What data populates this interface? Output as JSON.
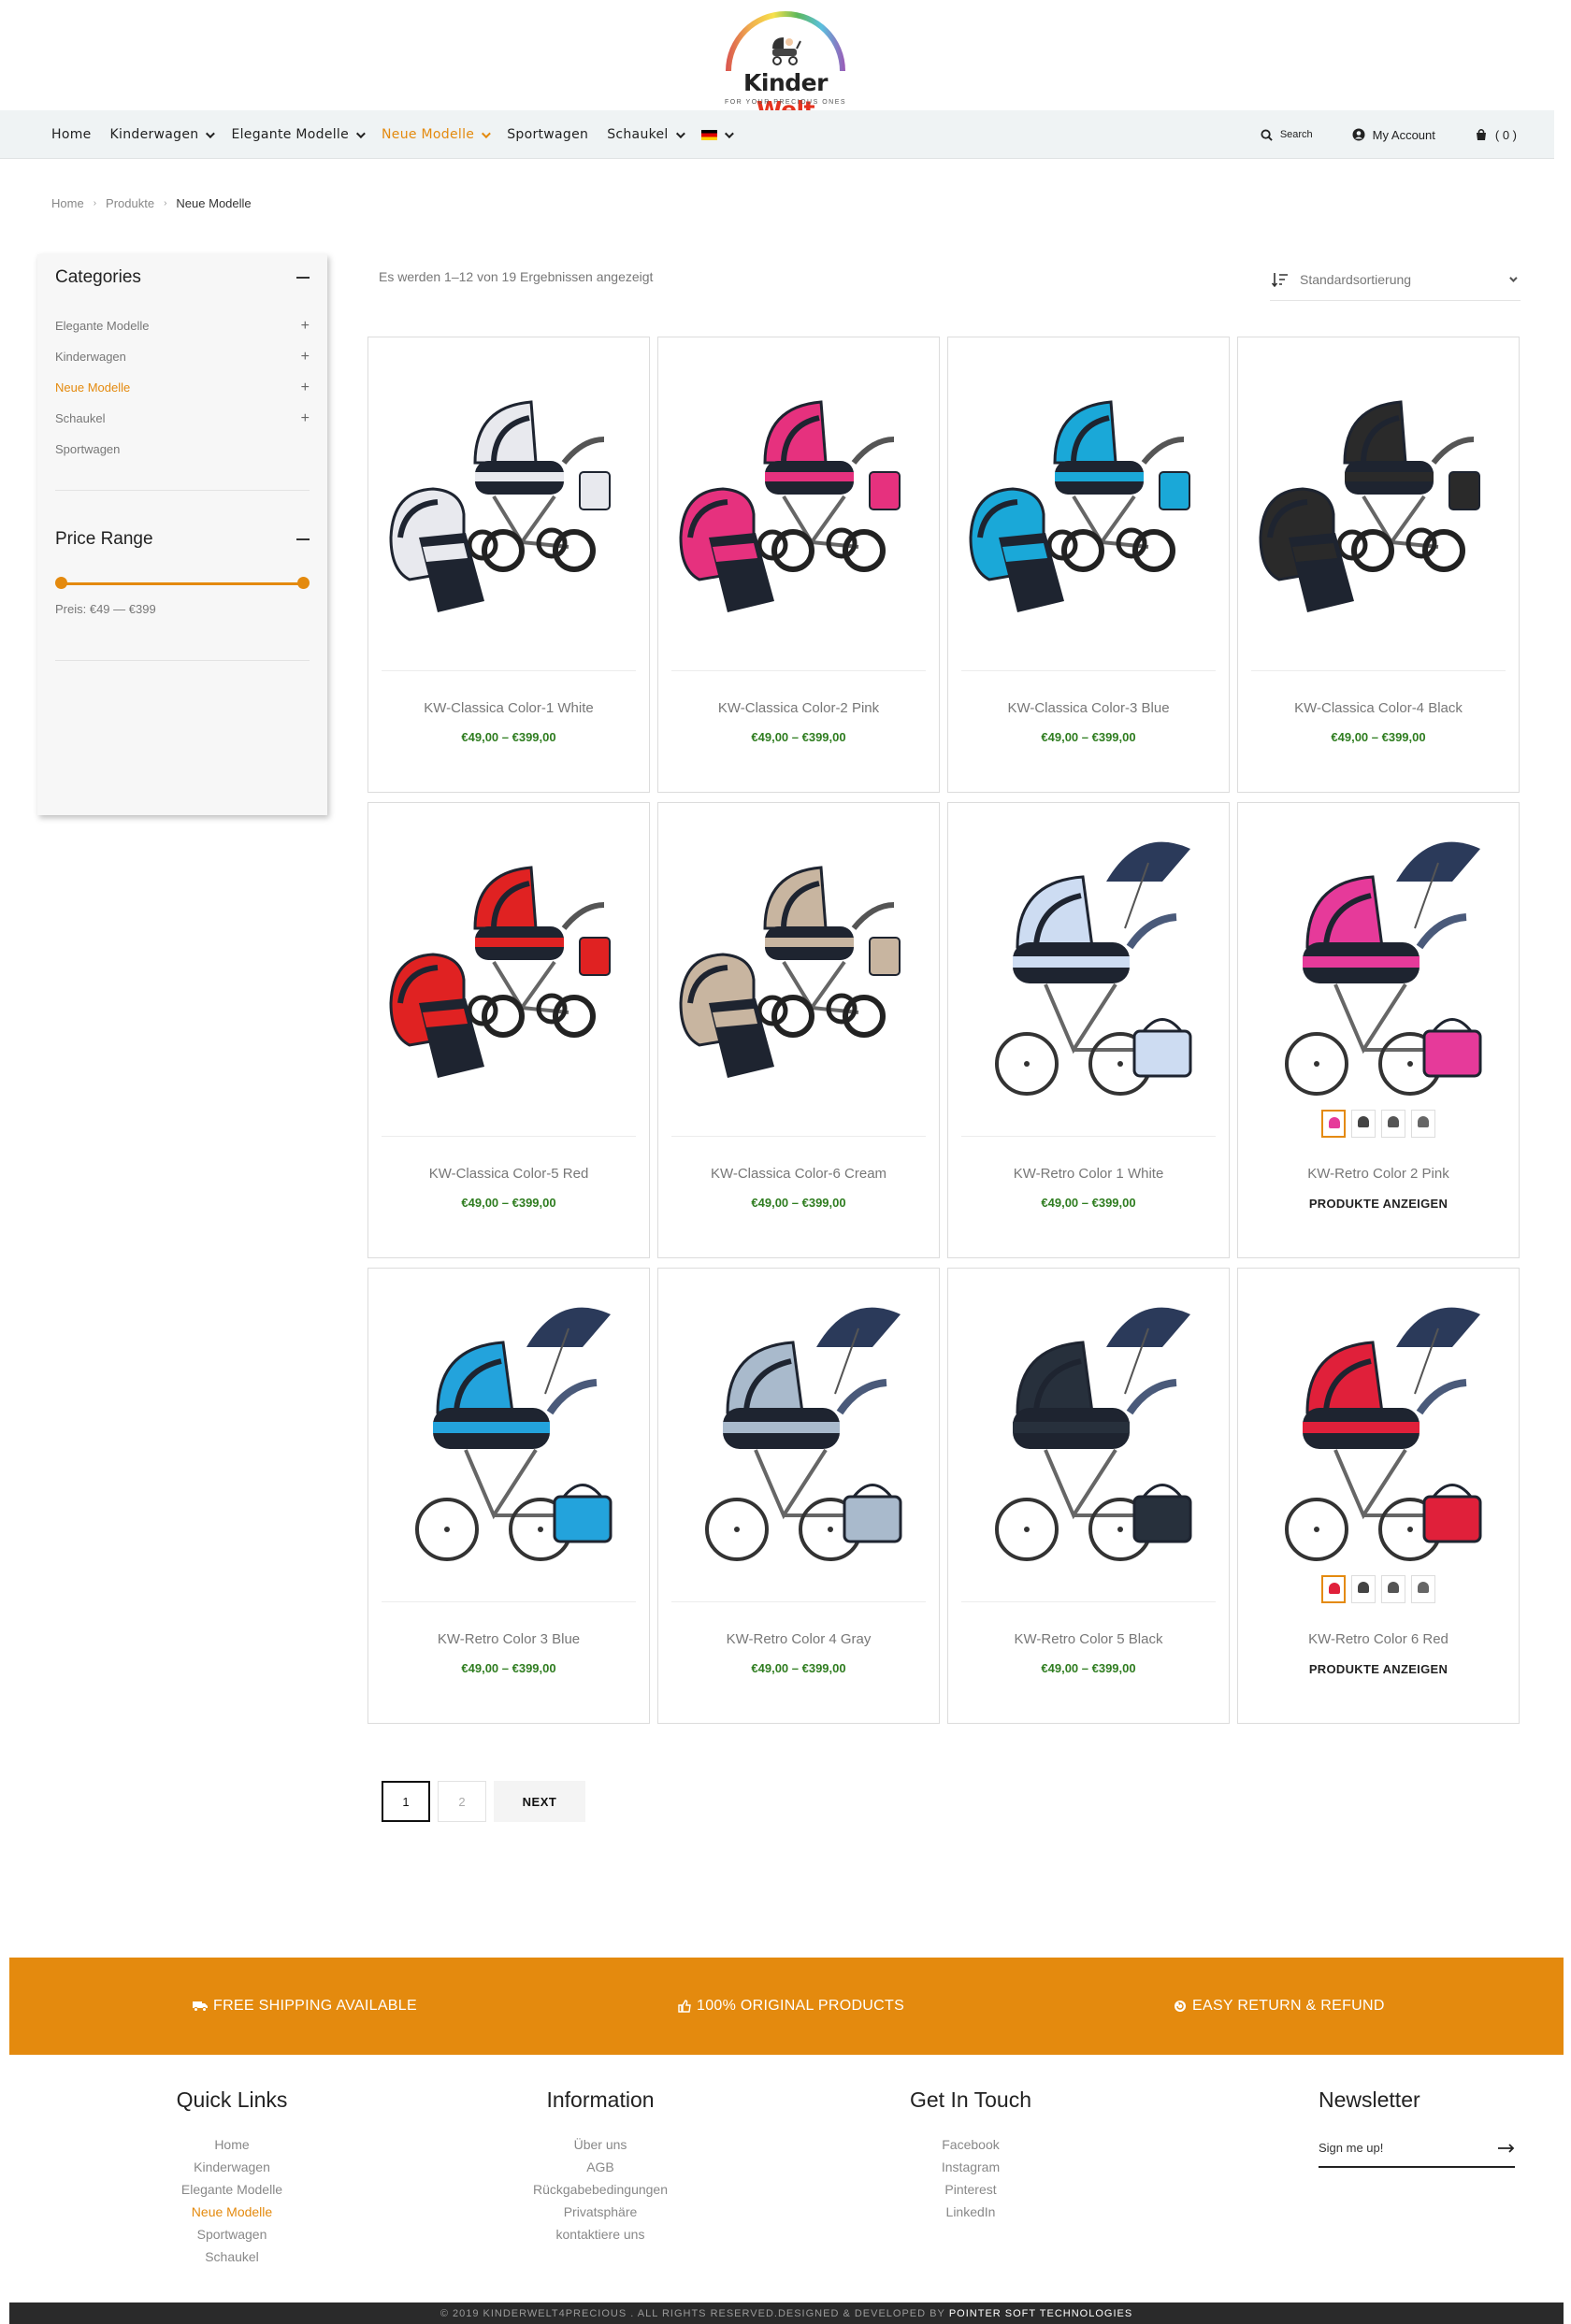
{
  "brand": {
    "name_part1": "Kinder",
    "name_part2": "Welt",
    "tagline": "FOR YOUR PRECIOUS ONES"
  },
  "nav": {
    "items": [
      {
        "label": "Home",
        "dropdown": false,
        "active": false
      },
      {
        "label": "Kinderwagen",
        "dropdown": true,
        "active": false
      },
      {
        "label": "Elegante Modelle",
        "dropdown": true,
        "active": false
      },
      {
        "label": "Neue Modelle",
        "dropdown": true,
        "active": true
      },
      {
        "label": "Sportwagen",
        "dropdown": false,
        "active": false
      },
      {
        "label": "Schaukel",
        "dropdown": true,
        "active": false
      }
    ],
    "search_label": "Search",
    "account_label": "My Account",
    "cart_label": "( 0 )"
  },
  "breadcrumb": [
    "Home",
    "Produkte",
    "Neue Modelle"
  ],
  "sidebar": {
    "categories_title": "Categories",
    "categories": [
      {
        "label": "Elegante Modelle",
        "expandable": true,
        "active": false
      },
      {
        "label": "Kinderwagen",
        "expandable": true,
        "active": false
      },
      {
        "label": "Neue Modelle",
        "expandable": true,
        "active": true
      },
      {
        "label": "Schaukel",
        "expandable": true,
        "active": false
      },
      {
        "label": "Sportwagen",
        "expandable": false,
        "active": false
      }
    ],
    "price_title": "Price Range",
    "price_label": "Preis: €49 — €399",
    "price_min": 49,
    "price_max": 399
  },
  "result_count": "Es werden 1–12 von 19 Ergebnissen angezeigt",
  "sort_label": "Standardsortierung",
  "products": [
    {
      "name": "KW-Classica Color-1 White",
      "price": "€49,00 – €399,00",
      "color": "#e8e9ee",
      "style": "classica"
    },
    {
      "name": "KW-Classica Color-2 Pink",
      "price": "€49,00 – €399,00",
      "color": "#e6317e",
      "style": "classica"
    },
    {
      "name": "KW-Classica Color-3 Blue",
      "price": "€49,00 – €399,00",
      "color": "#1aa8d8",
      "style": "classica"
    },
    {
      "name": "KW-Classica Color-4 Black",
      "price": "€49,00 – €399,00",
      "color": "#2a2a2a",
      "style": "classica"
    },
    {
      "name": "KW-Classica Color-5 Red",
      "price": "€49,00 – €399,00",
      "color": "#e02222",
      "style": "classica"
    },
    {
      "name": "KW-Classica Color-6 Cream",
      "price": "€49,00 – €399,00",
      "color": "#c8b5a0",
      "style": "classica"
    },
    {
      "name": "KW-Retro Color 1 White",
      "price": "€49,00 – €399,00",
      "color": "#cddcf2",
      "style": "retro"
    },
    {
      "name": "KW-Retro Color 2 Pink",
      "cta": "PRODUKTE ANZEIGEN",
      "color": "#e63a9a",
      "style": "retro",
      "swatches": [
        "#e63a9a",
        "#444",
        "#555",
        "#666"
      ]
    },
    {
      "name": "KW-Retro Color 3 Blue",
      "price": "€49,00 – €399,00",
      "color": "#23a3dc",
      "style": "retro"
    },
    {
      "name": "KW-Retro Color 4 Gray",
      "price": "€49,00 – €399,00",
      "color": "#a9bacc",
      "style": "retro"
    },
    {
      "name": "KW-Retro Color 5 Black",
      "price": "€49,00 – €399,00",
      "color": "#27303c",
      "style": "retro"
    },
    {
      "name": "KW-Retro Color 6 Red",
      "cta": "PRODUKTE ANZEIGEN",
      "color": "#e0203a",
      "style": "retro",
      "swatches": [
        "#e0203a",
        "#444",
        "#555",
        "#666"
      ]
    }
  ],
  "pagination": {
    "current": "1",
    "next_page": "2",
    "next_label": "NEXT"
  },
  "features": [
    "FREE SHIPPING AVAILABLE",
    "100% ORIGINAL PRODUCTS",
    "EASY RETURN & REFUND"
  ],
  "footer": {
    "quick_links": {
      "title": "Quick Links",
      "items": [
        "Home",
        "Kinderwagen",
        "Elegante Modelle",
        "Neue Modelle",
        "Sportwagen",
        "Schaukel"
      ]
    },
    "information": {
      "title": "Information",
      "items": [
        "Über uns",
        "AGB",
        "Rückgabebedingungen",
        "Privatsphäre",
        "kontaktiere uns"
      ]
    },
    "contact": {
      "title": "Get In Touch",
      "items": [
        "Facebook",
        "Instagram",
        "Pinterest",
        "LinkedIn"
      ]
    },
    "newsletter": {
      "title": "Newsletter",
      "placeholder": "Sign me up!"
    },
    "copyright": "© 2019 KINDERWELT4PRECIOUS . ALL RIGHTS RESERVED.DESIGNED & DEVELOPED BY",
    "developer": "POINTER SOFT TECHNOLOGIES"
  },
  "colors": {
    "accent": "#e48a0e",
    "price": "#2f7d20",
    "nav_bg": "#eff3f4"
  }
}
